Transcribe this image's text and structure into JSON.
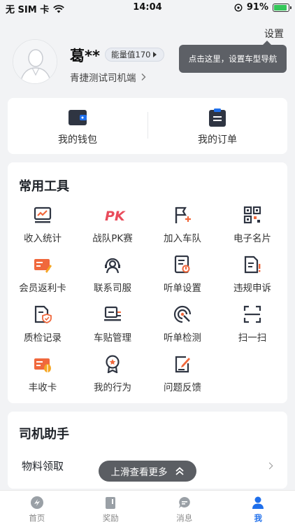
{
  "status_bar": {
    "carrier": "无 SIM 卡",
    "time": "14:04",
    "battery": "91%",
    "battery_level": 0.91
  },
  "header": {
    "settings_label": "设置",
    "tooltip": "点击这里，设置车型导航",
    "user_name": "葛**",
    "energy_label": "能量值170",
    "subtitle": "青捷测试司机端"
  },
  "quick_actions": [
    {
      "label": "我的钱包",
      "icon": "wallet-icon"
    },
    {
      "label": "我的订单",
      "icon": "order-clipboard-icon"
    }
  ],
  "tools": {
    "title": "常用工具",
    "items": [
      {
        "label": "收入统计",
        "icon": "income-chart-icon"
      },
      {
        "label": "战队PK赛",
        "icon": "pk-icon"
      },
      {
        "label": "加入车队",
        "icon": "flag-plus-icon"
      },
      {
        "label": "电子名片",
        "icon": "qr-code-icon"
      },
      {
        "label": "会员返利卡",
        "icon": "member-card-icon"
      },
      {
        "label": "联系司服",
        "icon": "customer-service-icon"
      },
      {
        "label": "听单设置",
        "icon": "order-settings-icon"
      },
      {
        "label": "违规申诉",
        "icon": "appeal-document-icon"
      },
      {
        "label": "质检记录",
        "icon": "inspection-record-icon"
      },
      {
        "label": "车贴管理",
        "icon": "car-sticker-icon"
      },
      {
        "label": "听单检测",
        "icon": "order-detect-icon"
      },
      {
        "label": "扫一扫",
        "icon": "scan-icon"
      },
      {
        "label": "丰收卡",
        "icon": "harvest-card-icon"
      },
      {
        "label": "我的行为",
        "icon": "behavior-badge-icon"
      },
      {
        "label": "问题反馈",
        "icon": "feedback-edit-icon"
      }
    ]
  },
  "assistant": {
    "title": "司机助手",
    "row_label": "物料领取"
  },
  "scroll_hint": "上滑查看更多",
  "tabs": [
    {
      "label": "首页",
      "icon": "home-logo-icon"
    },
    {
      "label": "奖励",
      "icon": "reward-icon"
    },
    {
      "label": "消息",
      "icon": "message-icon"
    },
    {
      "label": "我",
      "icon": "profile-icon"
    }
  ],
  "colors": {
    "accent": "#1f6feb",
    "dark_icon": "#2f3542",
    "orange": "#f0683c",
    "pk_red": "#e94b5b",
    "battery_green": "#34c759"
  }
}
